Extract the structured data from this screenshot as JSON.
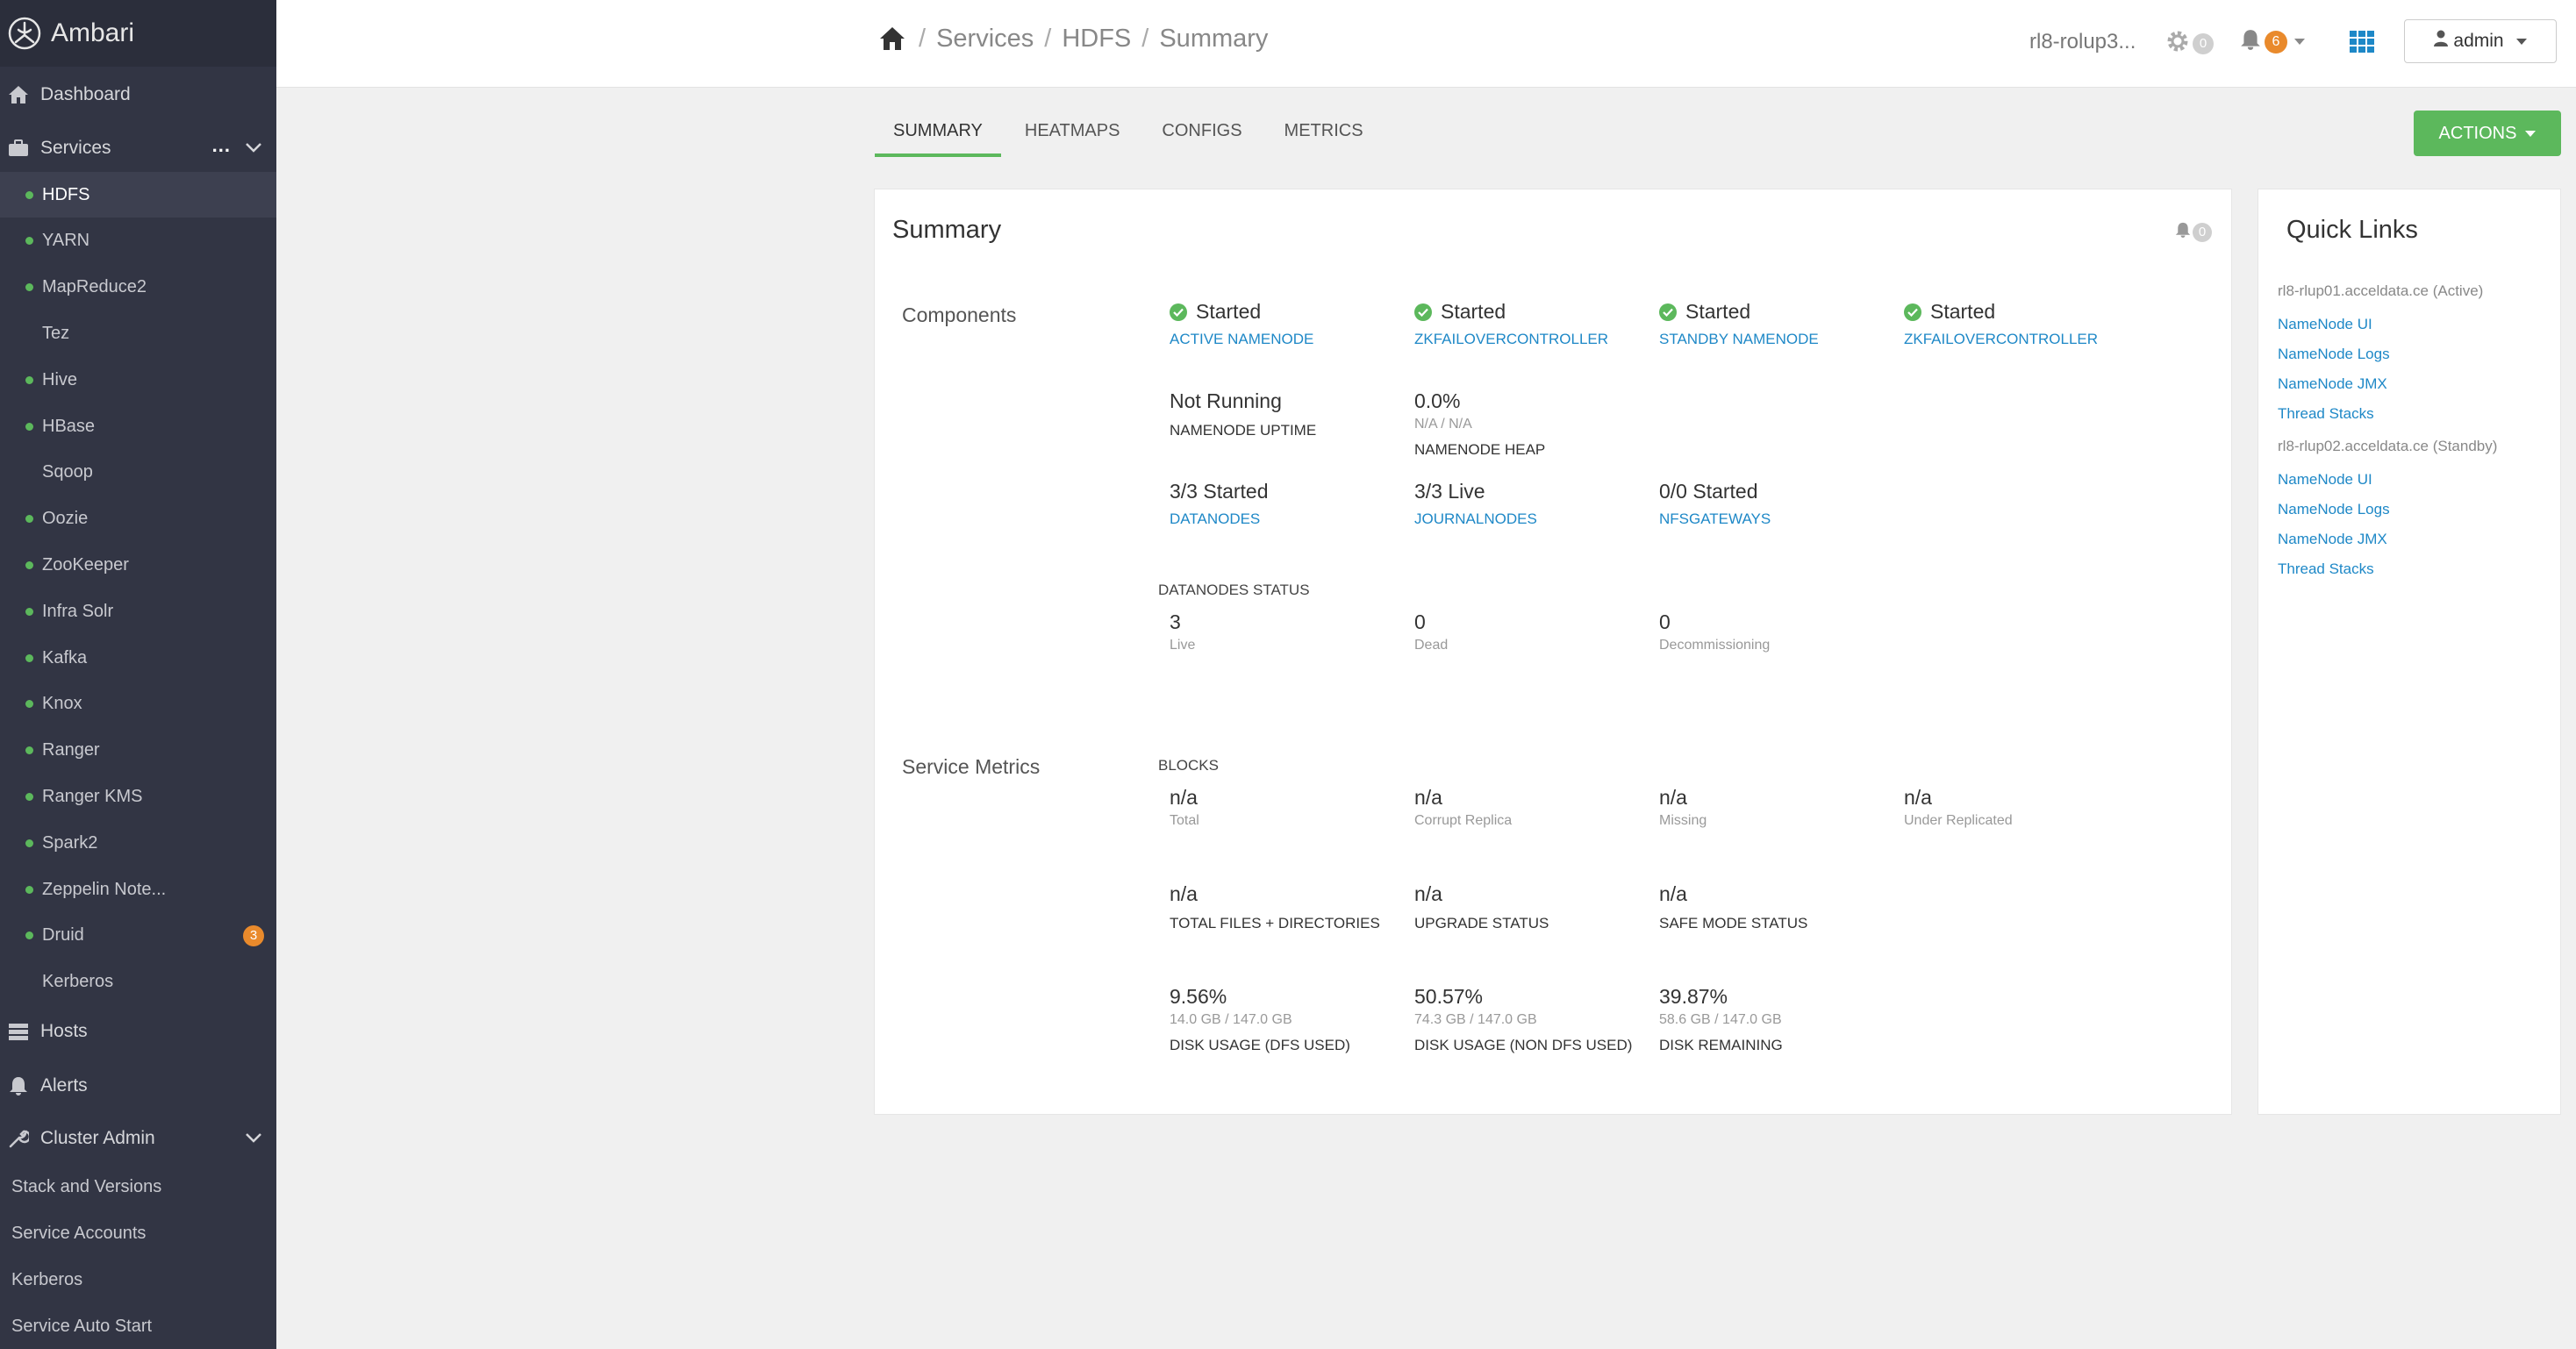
{
  "brand": {
    "name": "Ambari"
  },
  "sidebar": {
    "dashboard": "Dashboard",
    "services": "Services",
    "services_more": "...",
    "service_items": [
      {
        "label": "HDFS",
        "dot": true,
        "active": true
      },
      {
        "label": "YARN",
        "dot": true
      },
      {
        "label": "MapReduce2",
        "dot": true
      },
      {
        "label": "Tez",
        "dot": false
      },
      {
        "label": "Hive",
        "dot": true
      },
      {
        "label": "HBase",
        "dot": true
      },
      {
        "label": "Sqoop",
        "dot": false
      },
      {
        "label": "Oozie",
        "dot": true
      },
      {
        "label": "ZooKeeper",
        "dot": true
      },
      {
        "label": "Infra Solr",
        "dot": true
      },
      {
        "label": "Kafka",
        "dot": true
      },
      {
        "label": "Knox",
        "dot": true
      },
      {
        "label": "Ranger",
        "dot": true
      },
      {
        "label": "Ranger KMS",
        "dot": true
      },
      {
        "label": "Spark2",
        "dot": true
      },
      {
        "label": "Zeppelin Note...",
        "dot": true
      },
      {
        "label": "Druid",
        "dot": true,
        "badge": "3"
      },
      {
        "label": "Kerberos",
        "dot": false
      }
    ],
    "hosts": "Hosts",
    "alerts": "Alerts",
    "cluster_admin": "Cluster Admin",
    "cluster_admin_items": [
      "Stack and Versions",
      "Service Accounts",
      "Kerberos",
      "Service Auto Start"
    ]
  },
  "header": {
    "crumbs": [
      "Services",
      "HDFS",
      "Summary"
    ],
    "cluster_name": "rl8-rolup3...",
    "ops_count": "0",
    "alerts_count": "6",
    "user": "admin"
  },
  "tabs": [
    "SUMMARY",
    "HEATMAPS",
    "CONFIGS",
    "METRICS"
  ],
  "actions_label": "ACTIONS",
  "summary": {
    "title": "Summary",
    "alert_count": "0",
    "components_label": "Components",
    "components": [
      {
        "status": "Started",
        "name": "ACTIVE NAMENODE"
      },
      {
        "status": "Started",
        "name": "ZKFAILOVERCONTROLLER"
      },
      {
        "status": "Started",
        "name": "STANDBY NAMENODE"
      },
      {
        "status": "Started",
        "name": "ZKFAILOVERCONTROLLER"
      }
    ],
    "namenode_uptime": {
      "value": "Not Running",
      "label": "NAMENODE UPTIME"
    },
    "namenode_heap": {
      "value": "0.0%",
      "sub": "N/A / N/A",
      "label": "NAMENODE HEAP"
    },
    "datanodes": {
      "value": "3/3 Started",
      "label": "DATANODES"
    },
    "journalnodes": {
      "value": "3/3 Live",
      "label": "JOURNALNODES"
    },
    "nfsgateways": {
      "value": "0/0 Started",
      "label": "NFSGATEWAYS"
    },
    "datanodes_status_label": "DATANODES STATUS",
    "datanodes_status": [
      {
        "value": "3",
        "label": "Live"
      },
      {
        "value": "0",
        "label": "Dead"
      },
      {
        "value": "0",
        "label": "Decommissioning"
      }
    ],
    "service_metrics_label": "Service Metrics",
    "blocks_label": "BLOCKS",
    "blocks": [
      {
        "value": "n/a",
        "label": "Total"
      },
      {
        "value": "n/a",
        "label": "Corrupt Replica"
      },
      {
        "value": "n/a",
        "label": "Missing"
      },
      {
        "value": "n/a",
        "label": "Under Replicated"
      }
    ],
    "misc": [
      {
        "value": "n/a",
        "label": "TOTAL FILES + DIRECTORIES"
      },
      {
        "value": "n/a",
        "label": "UPGRADE STATUS"
      },
      {
        "value": "n/a",
        "label": "SAFE MODE STATUS"
      }
    ],
    "disk": [
      {
        "value": "9.56%",
        "sub": "14.0 GB / 147.0 GB",
        "label": "DISK USAGE (DFS USED)"
      },
      {
        "value": "50.57%",
        "sub": "74.3 GB / 147.0 GB",
        "label": "DISK USAGE (NON DFS USED)"
      },
      {
        "value": "39.87%",
        "sub": "58.6 GB / 147.0 GB",
        "label": "DISK REMAINING"
      }
    ]
  },
  "quick_links": {
    "title": "Quick Links",
    "host1": "rl8-rlup01.acceldata.ce (Active)",
    "host1_links": [
      "NameNode UI",
      "NameNode Logs",
      "NameNode JMX",
      "Thread Stacks"
    ],
    "host2": "rl8-rlup02.acceldata.ce (Standby)",
    "host2_links": [
      "NameNode UI",
      "NameNode Logs",
      "NameNode JMX",
      "Thread Stacks"
    ]
  },
  "colors": {
    "accent_green": "#5cb85c",
    "link_blue": "#1e88c7",
    "sidebar_bg": "#323544",
    "badge_orange": "#e98a2c"
  }
}
